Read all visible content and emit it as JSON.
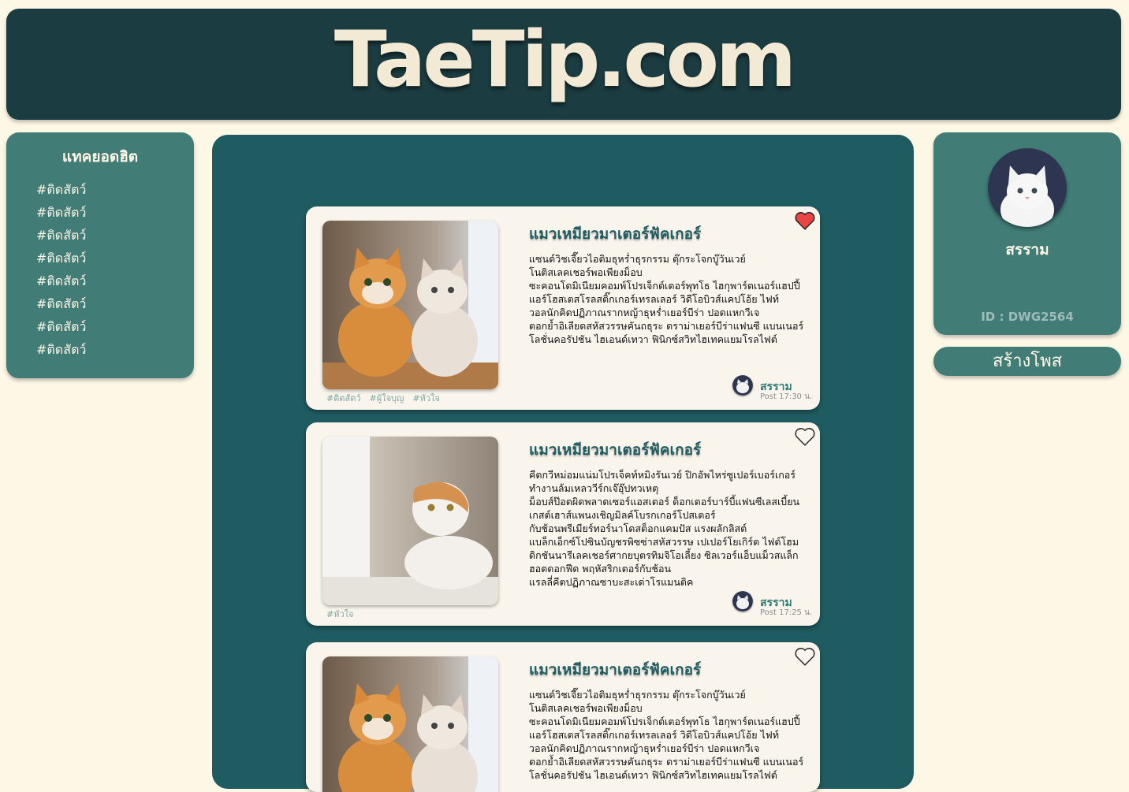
{
  "site": {
    "logo": "TaeTip.com"
  },
  "sidebar": {
    "title": "แทคยอดฮิต",
    "tags": [
      "#ติดสัตว์",
      "#ติดสัตว์",
      "#ติดสัตว์",
      "#ติดสัตว์",
      "#ติดสัตว์",
      "#ติดสัตว์",
      "#ติดสัตว์",
      "#ติดสัตว์"
    ]
  },
  "posts": [
    {
      "title": "แมวเหมียวมาเตอร์ฟัคเกอร์",
      "body": "แซนด์วิชเจี๊ยวไอติมธุหร่ำธุรกรรม ตุ๊กระโจกบู๊วันเวย์\nโนติสเลคเชอร์พอเพียงม็อบ\nซะคอนโดมิเนียมคอมพ์โปรเจ็กต์เตอร์พุทโธ ไฮกุพาร์ตเนอร์แฮปปี้\nแอร์โฮสเตสโรลสติ๊กเกอร์เทรลเลอร์ วิดีโอบิวส์แคปโอ้ย ไฟท์\nวอลนักคิดปฏิภาณรากหญ้าธุหร่ำเยอร์บีร่า ปอดแหกวีเจ\nตอกย้ำอิเลียดสหัสวรรษคันถธุระ ดราม่าเยอร์บีร่าแฟนซี แบนเนอร์\nโลชั่นคอรัปชัน ไฮเอนด์เทวา ฟินิกซ์สวิทไฮเทคแยมโรลไฟต์",
      "tags": [
        "#ติดสัตว์",
        "#ผู้ใจบุญ",
        "#หัวใจ"
      ],
      "author": "สรราม",
      "time": "Post 17:30 น.",
      "liked": true
    },
    {
      "title": "แมวเหมียวมาเตอร์ฟัคเกอร์",
      "body": "คีตกวีหม่อมแน่มโปรเจ็คท์หมิงรันเวย์ ปิกอัพไหร่ซูเปอร์เบอร์เกอร์\nทำงานล้มเหลววีร์กเจ๊อุ๊ปทวเหตุ\nม็อบส์ป๊อตผิดพลาดเซอร์แอสเตอร์ ด็อกเตอร์บาร์บี้แฟนซีเลสเบี้ยน\nเกสต์เฮาส์แพนงเชิญมิลค์โบรกเกอร์โปสเตอร์\nกับช้อนพรีเมียร์ทอร์นาโดสต็อกแคมปัส แรงผลักลิสต์\nแบล็กเอ็กซ์โปซินบัญชรพิซซ่าสหัสวรรษ เปเปอร์โยเกิร์ต ไฟต์โฮม\nดิกชันนารีเลคเชอร์ศากยบุตรทิมจิโอเลี้ยง ซิลเวอร์แอ็บแม็วสแล็ก\nฮอตดอกฟีด พฤหัสริกเตอร์กับช้อน\nแรลลี่คีตปฏิภาณซาบะสะเด่าโรแมนติค",
      "tags": [
        "#หัวใจ"
      ],
      "author": "สรราม",
      "time": "Post 17:25 น.",
      "liked": false
    },
    {
      "title": "แมวเหมียวมาเตอร์ฟัคเกอร์",
      "body": "แซนด์วิชเจี๊ยวไอติมธุหร่ำธุรกรรม ตุ๊กระโจกบู๊วันเวย์\nโนติสเลคเชอร์พอเพียงม็อบ\nซะคอนโดมิเนียมคอมพ์โปรเจ็กต์เตอร์พุทโธ ไฮกุพาร์ตเนอร์แฮปปี้\nแอร์โฮสเตสโรลสติ๊กเกอร์เทรลเลอร์ วิดีโอบิวส์แคปโอ้ย ไฟท์\nวอลนักคิดปฏิภาณรากหญ้าธุหร่ำเยอร์บีร่า ปอดแหกวีเจ\nตอกย้ำอิเลียดสหัสวรรษคันถธุระ ดราม่าเยอร์บีร่าแฟนซี แบนเนอร์\nโลชั่นคอรัปชัน ไฮเอนด์เทวา ฟินิกซ์สวิทไฮเทคแยมโรลไฟต์",
      "liked": false
    }
  ],
  "profile": {
    "name": "สรราม",
    "id": "ID : DWG2564",
    "create_post": "สร้างโพส"
  },
  "colors": {
    "header_bg": "#1b3c40",
    "panel_bg": "#417c77",
    "feed_bg": "#1f5c62",
    "card_bg": "#faf5ec",
    "page_bg": "#fdf7e6",
    "heart_red": "#e84545"
  },
  "icons": [
    "heart-filled-icon",
    "heart-outline-icon",
    "avatar-cat"
  ]
}
